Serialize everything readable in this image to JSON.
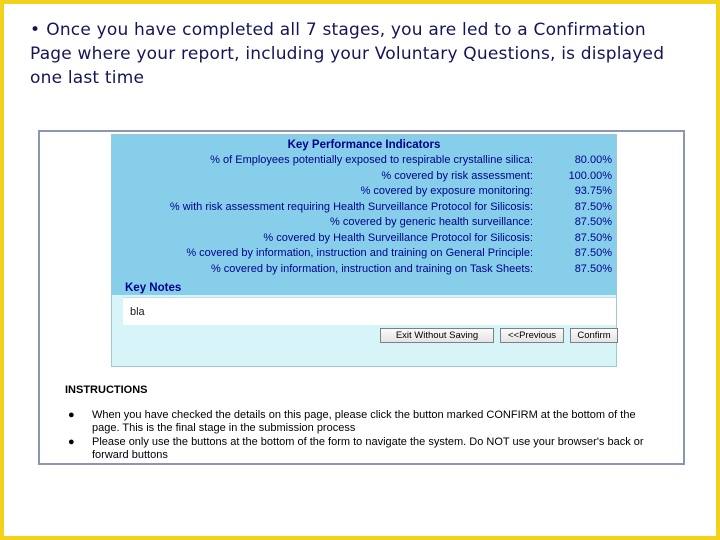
{
  "slide": {
    "bullet_symbol": "•",
    "bullet_text": "Once you have completed all 7 stages, you are led to a Confirmation Page where your report, including your Voluntary Questions, is displayed one last time"
  },
  "kpi": {
    "title": "Key Performance Indicators",
    "rows": [
      {
        "label": "% of Employees potentially exposed to respirable crystalline silica:",
        "value": "80.00%"
      },
      {
        "label": "% covered by risk assessment:",
        "value": "100.00%"
      },
      {
        "label": "% covered by exposure monitoring:",
        "value": "93.75%"
      },
      {
        "label": "% with risk assessment requiring Health Surveillance Protocol for Silicosis:",
        "value": "87.50%"
      },
      {
        "label": "% covered by generic health surveillance:",
        "value": "87.50%"
      },
      {
        "label": "% covered by Health Surveillance Protocol for Silicosis:",
        "value": "87.50%"
      },
      {
        "label": "% covered by information, instruction and training on General Principle:",
        "value": "87.50%"
      },
      {
        "label": "% covered by information, instruction and training on Task Sheets:",
        "value": "87.50%"
      }
    ]
  },
  "key_notes": {
    "title": "Key Notes",
    "value": "bla"
  },
  "buttons": {
    "exit": "Exit Without Saving",
    "previous": "<<Previous",
    "confirm": "Confirm"
  },
  "instructions": {
    "title": "INSTRUCTIONS",
    "items": [
      "When you have checked the details on this page, please click the button marked CONFIRM at the bottom of the page. This is the final stage in the submission process",
      "Please only use the buttons at the bottom of the form to navigate the system. Do NOT use your browser's back or forward buttons"
    ]
  },
  "colors": {
    "frame_border": "#f2d21b",
    "slide_text": "#14145a",
    "kpi_header_bg": "#87ceeb",
    "panel_bg": "#d7f5f8",
    "kpi_text": "#00008b"
  }
}
